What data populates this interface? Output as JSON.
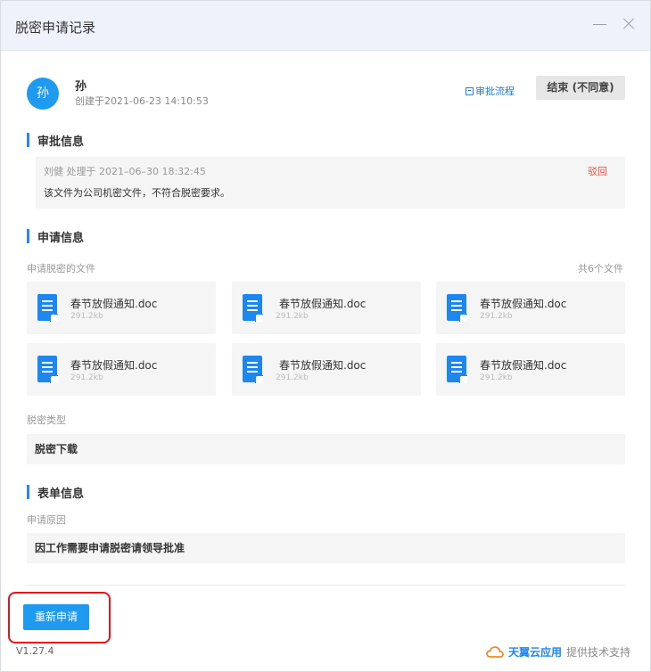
{
  "window": {
    "title": "脱密申请记录"
  },
  "requester": {
    "avatar_text": "孙",
    "name": "孙",
    "created": "创建于2021-06-23 14:10:53",
    "flow_link": "审批流程",
    "end_button": "结束 (不同意)"
  },
  "approval": {
    "section_title": "审批信息",
    "meta": "刘健 处理于 2021–06–30 18:32:45",
    "status": "驳回",
    "comment": "该文件为公司机密文件，不符合脱密要求。"
  },
  "application": {
    "section_title": "申请信息",
    "files_label": "申请脱密的文件",
    "files_count": "共6个文件",
    "files": [
      {
        "name": "春节放假通知.doc",
        "size": "291.2kb"
      },
      {
        "name": "春节放假通知.doc",
        "size": "291.2kb"
      },
      {
        "name": "春节放假通知.doc",
        "size": "291.2kb"
      },
      {
        "name": "春节放假通知.doc",
        "size": "291.2kb"
      },
      {
        "name": "春节放假通知.doc",
        "size": "291.2kb"
      },
      {
        "name": "春节放假通知.doc",
        "size": "291.2kb"
      }
    ],
    "type_label": "脱密类型",
    "type_value": "脱密下载"
  },
  "form": {
    "section_title": "表单信息",
    "reason_label": "申请原因",
    "reason_value": "因工作需要申请脱密请领导批准"
  },
  "footer": {
    "reapply_button": "重新申请",
    "version": "V1.27.4",
    "brand_name": "天翼云应用",
    "brand_sub": "提供技术支持"
  },
  "colors": {
    "accent": "#1e9bf0",
    "reject": "#f5503a",
    "highlight": "#e5141c"
  }
}
